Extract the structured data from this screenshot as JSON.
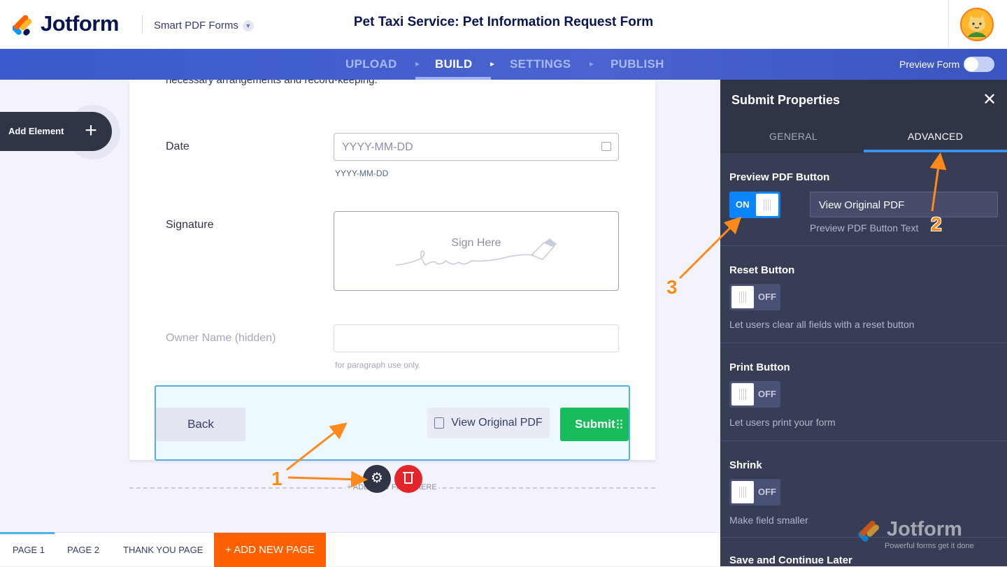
{
  "app": {
    "brand": "Jotform",
    "product": "Smart PDF Forms",
    "form_title": "Pet Taxi Service: Pet Information Request Form"
  },
  "nav": {
    "steps": [
      "UPLOAD",
      "BUILD",
      "SETTINGS",
      "PUBLISH"
    ],
    "active_step": "BUILD",
    "preview_label": "Preview Form",
    "preview_on": false
  },
  "canvas": {
    "add_element_label": "Add Element",
    "cut_off_text": "necessary arrangements and record-keeping.",
    "fields": {
      "date": {
        "label": "Date",
        "placeholder": "YYYY-MM-DD",
        "sublabel": "YYYY-MM-DD"
      },
      "signature": {
        "label": "Signature",
        "placeholder": "Sign Here"
      },
      "owner_name": {
        "label": "Owner Name (hidden)",
        "sublabel": "for paragraph use only."
      }
    },
    "buttons": {
      "back": "Back",
      "view_pdf": "View Original PDF",
      "submit": "Submit"
    },
    "add_new_field": "+ ADD NEW FIELD HERE"
  },
  "page_tabs": {
    "tabs": [
      "PAGE 1",
      "PAGE 2",
      "THANK YOU PAGE"
    ],
    "active": "PAGE 1",
    "add_page": "+ ADD NEW PAGE"
  },
  "panel": {
    "title": "Submit Properties",
    "tabs": [
      "GENERAL",
      "ADVANCED"
    ],
    "active_tab": "ADVANCED",
    "sections": {
      "preview_pdf": {
        "label": "Preview PDF Button",
        "toggle": "ON",
        "text_value": "View Original PDF",
        "text_sub": "Preview PDF Button Text"
      },
      "reset": {
        "label": "Reset Button",
        "toggle": "OFF",
        "desc": "Let users clear all fields with a reset button"
      },
      "print": {
        "label": "Print Button",
        "toggle": "OFF",
        "desc": "Let users print your form"
      },
      "shrink": {
        "label": "Shrink",
        "toggle": "OFF",
        "desc": "Make field smaller"
      },
      "save_continue": {
        "label": "Save and Continue Later"
      }
    }
  },
  "watermark": {
    "brand": "Jotform",
    "tagline": "Powerful forms get it done"
  },
  "annotations": [
    "1",
    "2",
    "3"
  ],
  "colors": {
    "nav_bg": "#4a63cf",
    "panel_bg": "#383d56",
    "submit_green": "#18bd5b",
    "add_page_orange": "#ff6100",
    "toggle_on_blue": "#0a84ff",
    "annotation_orange": "#ff8a1c"
  }
}
